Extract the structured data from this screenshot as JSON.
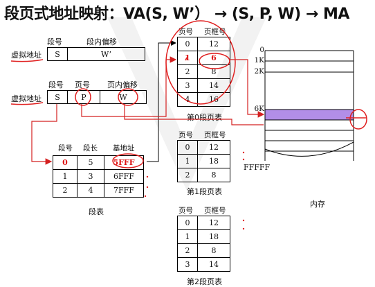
{
  "title": "段页式地址映射：VA(S, W’） → (S, P, W) → MA",
  "va1": {
    "label": "虚拟地址",
    "header_seg": "段号",
    "header_offset": "段内偏移",
    "cell_s": "S",
    "cell_w": "W’"
  },
  "va2": {
    "label": "虚拟地址",
    "header_seg": "段号",
    "header_page": "页号",
    "header_offset": "页内偏移",
    "cell_s": "S",
    "cell_p": "P",
    "cell_w": "W"
  },
  "seg_table": {
    "caption": "段表",
    "headers": [
      "段号",
      "段长",
      "基地址"
    ],
    "rows": [
      [
        "0",
        "5",
        "5FFF"
      ],
      [
        "1",
        "3",
        "6FFF"
      ],
      [
        "2",
        "4",
        "7FFF"
      ]
    ]
  },
  "page_table_0": {
    "caption": "第0段页表",
    "headers": [
      "页号",
      "页框号"
    ],
    "rows": [
      [
        "0",
        "12"
      ],
      [
        "1",
        "6"
      ],
      [
        "2",
        "8"
      ],
      [
        "3",
        "14"
      ],
      [
        "4",
        "16"
      ]
    ]
  },
  "page_table_1": {
    "caption": "第1段页表",
    "headers": [
      "页号",
      "页框号"
    ],
    "rows": [
      [
        "0",
        "12"
      ],
      [
        "1",
        "18"
      ],
      [
        "2",
        "8"
      ]
    ]
  },
  "page_table_2": {
    "caption": "第2段页表",
    "headers": [
      "页号",
      "页框号"
    ],
    "rows": [
      [
        "0",
        "12"
      ],
      [
        "1",
        "18"
      ],
      [
        "2",
        "8"
      ],
      [
        "3",
        "14"
      ]
    ]
  },
  "memory": {
    "caption": "内存",
    "labels": [
      "0",
      "1K",
      "2K",
      "6K",
      "FFFFF"
    ],
    "highlight_color": "#b28ee8"
  },
  "colors": {
    "annotation": "#e02020",
    "arrow": "#d42020"
  }
}
